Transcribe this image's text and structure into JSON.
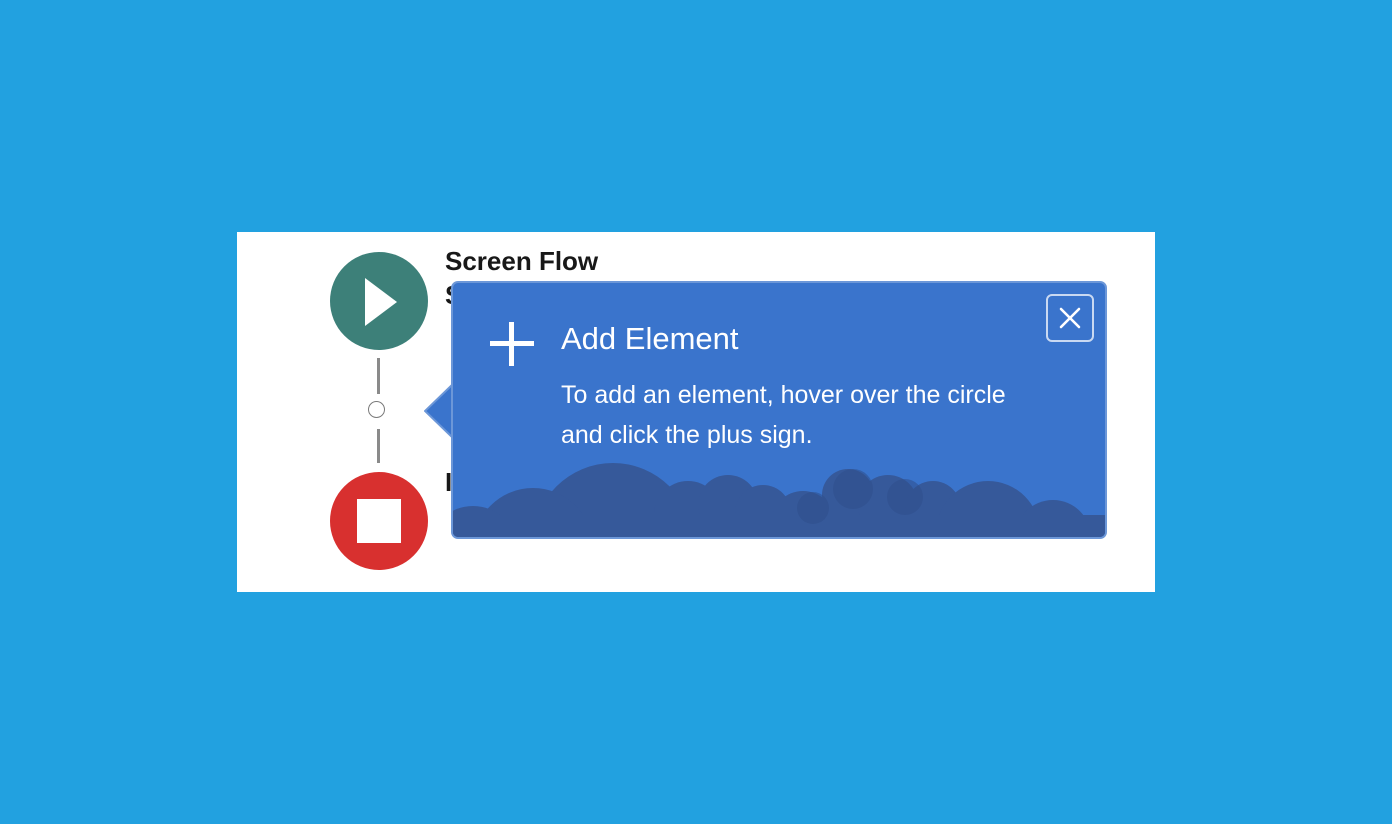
{
  "flow": {
    "title": "Screen Flow",
    "subtitle_visible": "S",
    "end_label_visible": "I"
  },
  "popover": {
    "heading": "Add Element",
    "body": "To add an element, hover over the circle and click the plus sign.",
    "close_icon": "close-icon",
    "plus_icon": "plus-icon"
  },
  "colors": {
    "background": "#22a1e0",
    "start_node": "#3d8079",
    "end_node": "#d8302f",
    "popover": "#3a74cc",
    "clouds": "#36599a"
  }
}
